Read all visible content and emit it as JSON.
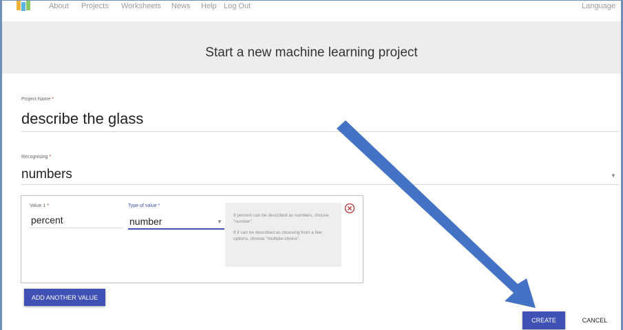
{
  "nav": {
    "items": [
      "About",
      "Projects",
      "Worksheets",
      "News",
      "Help",
      "Log Out"
    ],
    "language": "Language"
  },
  "header": {
    "title": "Start a new machine learning project"
  },
  "form": {
    "project_name": {
      "label": "Project Name",
      "required_mark": "*",
      "value": "describe the glass"
    },
    "recognising": {
      "label": "Recognising",
      "required_mark": "*",
      "value": "numbers"
    },
    "value1": {
      "label": "Value 1",
      "required_mark": "*",
      "value": "percent",
      "type_label": "Type of value",
      "type_value": "number"
    },
    "hint": [
      "If percent can be described as numbers, choose \"number\".",
      "If it can be described as choosing from a few options, choose \"multiple-choice\"."
    ],
    "add_button": "ADD ANOTHER VALUE",
    "create_button": "CREATE",
    "cancel_button": "CANCEL"
  },
  "colors": {
    "accent": "#3f51b5",
    "arrow": "#4472c4",
    "remove_icon": "#c0504d",
    "header_bg": "#ededed"
  },
  "icons": {
    "logo": "app-logo-icon",
    "remove": "remove-circle-icon",
    "dropdown": "caret-down-icon"
  }
}
